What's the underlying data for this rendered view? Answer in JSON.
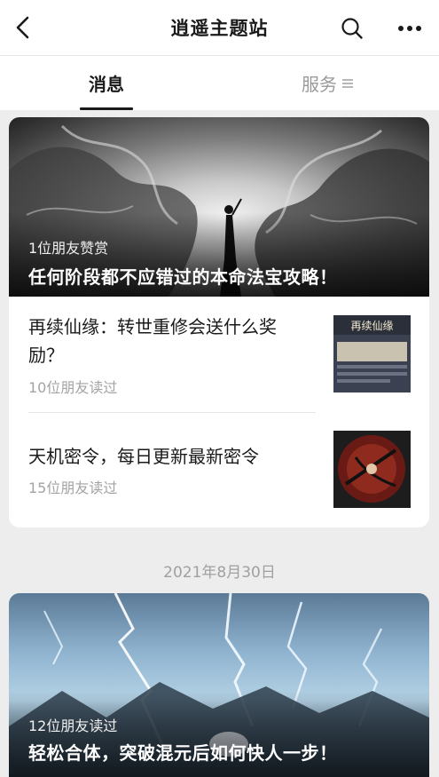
{
  "header": {
    "title": "逍遥主题站",
    "icons": [
      "back-chevron-icon",
      "search-icon",
      "more-dots-icon"
    ]
  },
  "tabs": [
    {
      "label": "消息",
      "active": true
    },
    {
      "label": "服务",
      "active": false,
      "icon": "menu-lines-icon"
    }
  ],
  "feed": {
    "featured": {
      "meta": "1位朋友赞赏",
      "title": "任何阶段都不应错过的本命法宝攻略！"
    },
    "articles": [
      {
        "title": "再续仙缘：转世重修会送什么奖励？",
        "meta": "10位朋友读过",
        "thumb_text": "再续仙缘"
      },
      {
        "title": "天机密令，每日更新最新密令",
        "meta": "15位朋友读过"
      }
    ],
    "date": "2021年8月30日",
    "featured2": {
      "meta": "12位朋友读过",
      "title": "轻松合体，突破混元后如何快人一步！"
    }
  },
  "colors": {
    "background": "#ededed",
    "card": "#ffffff",
    "text_primary": "#1a1a1a",
    "text_secondary": "#a3a3a3"
  }
}
